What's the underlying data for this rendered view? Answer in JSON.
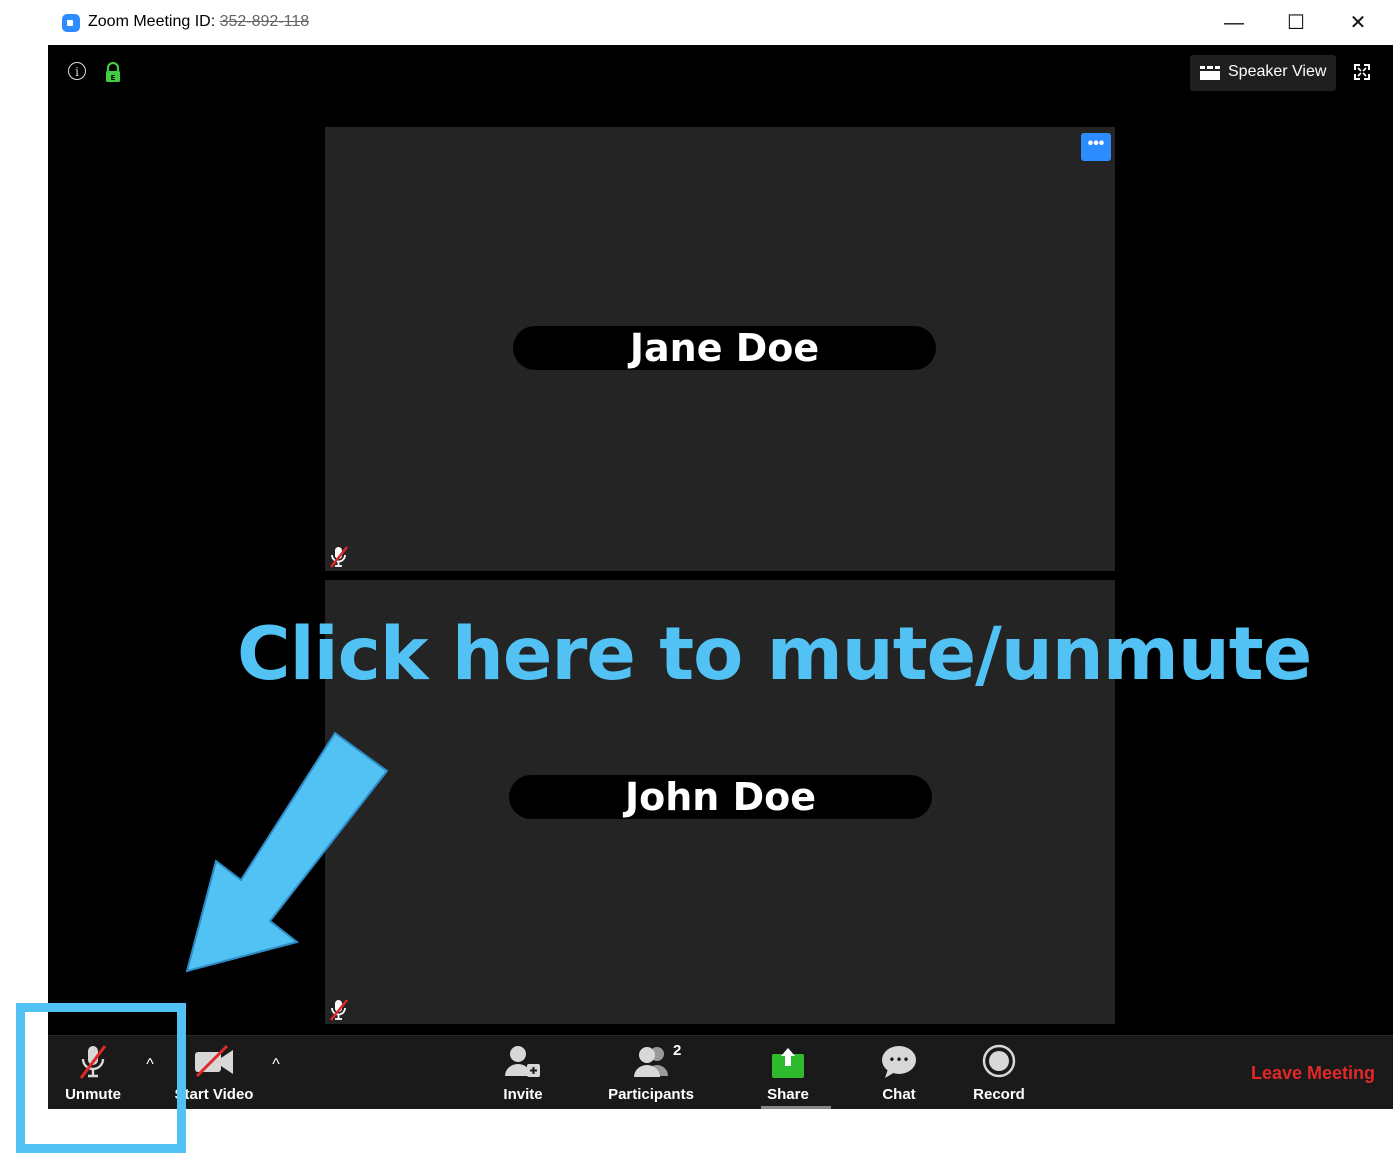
{
  "window": {
    "title_prefix": "Zoom Meeting ID: ",
    "meeting_id": "352-892-118",
    "minimize_glyph": "—",
    "maximize_glyph": "☐",
    "close_glyph": "✕"
  },
  "topbar": {
    "info_glyph": "i",
    "encryption_badge": "E",
    "speaker_view_label": "Speaker View"
  },
  "participants": [
    {
      "name": "Jane Doe",
      "muted": true
    },
    {
      "name": "John Doe",
      "muted": true
    }
  ],
  "tile_menu_glyph": "•••",
  "toolbar": {
    "unmute_label": "Unmute",
    "start_video_label": "Start Video",
    "invite_label": "Invite",
    "participants_label": "Participants",
    "participants_count": "2",
    "share_label": "Share",
    "chat_label": "Chat",
    "chat_glyph": "•••",
    "record_label": "Record",
    "leave_label": "Leave Meeting",
    "caret_glyph": "^"
  },
  "annotation": {
    "text": "Click here to mute/unmute",
    "color": "#52c2f4"
  },
  "colors": {
    "accent": "#2d8cff",
    "share_green": "#2dbb2d",
    "leave_red": "#e02828",
    "mute_slash": "#e02828"
  }
}
